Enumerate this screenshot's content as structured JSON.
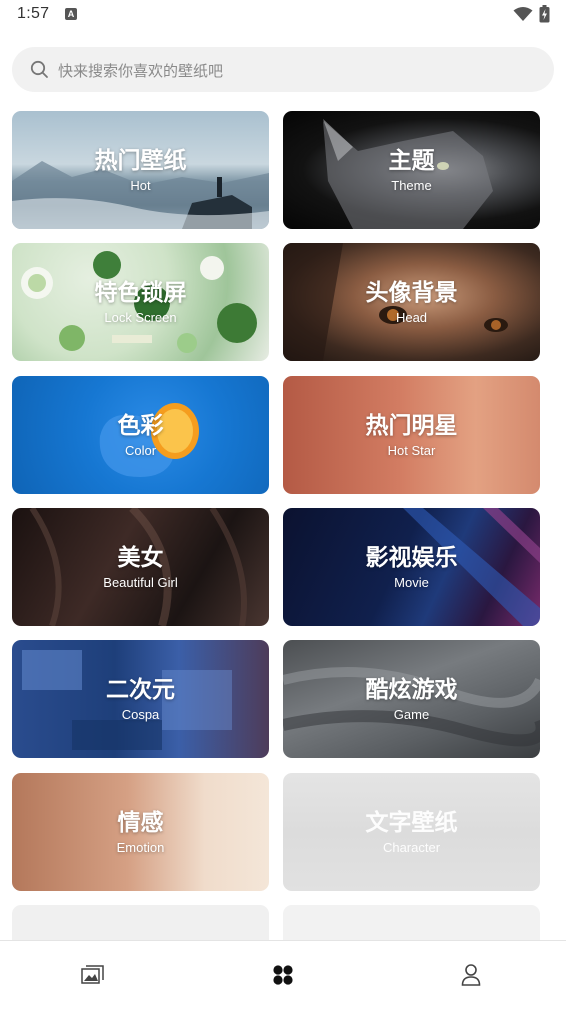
{
  "status_bar": {
    "time": "1:57",
    "notification_icon": "A"
  },
  "search": {
    "placeholder": "快来搜索你喜欢的壁纸吧",
    "value": ""
  },
  "categories": [
    {
      "zh": "热门壁纸",
      "en": "Hot"
    },
    {
      "zh": "主题",
      "en": "Theme"
    },
    {
      "zh": "特色锁屏",
      "en": "Lock Screen"
    },
    {
      "zh": "头像背景",
      "en": "Head"
    },
    {
      "zh": "色彩",
      "en": "Color"
    },
    {
      "zh": "热门明星",
      "en": "Hot Star"
    },
    {
      "zh": "美女",
      "en": "Beautiful Girl"
    },
    {
      "zh": "影视娱乐",
      "en": "Movie"
    },
    {
      "zh": "二次元",
      "en": "Cospa"
    },
    {
      "zh": "酷炫游戏",
      "en": "Game"
    },
    {
      "zh": "情感",
      "en": "Emotion"
    },
    {
      "zh": "文字壁纸",
      "en": "Character"
    }
  ],
  "bottom_nav": [
    {
      "icon": "gallery-icon",
      "active": false
    },
    {
      "icon": "category-grid-icon",
      "active": true
    },
    {
      "icon": "person-icon",
      "active": false
    }
  ]
}
